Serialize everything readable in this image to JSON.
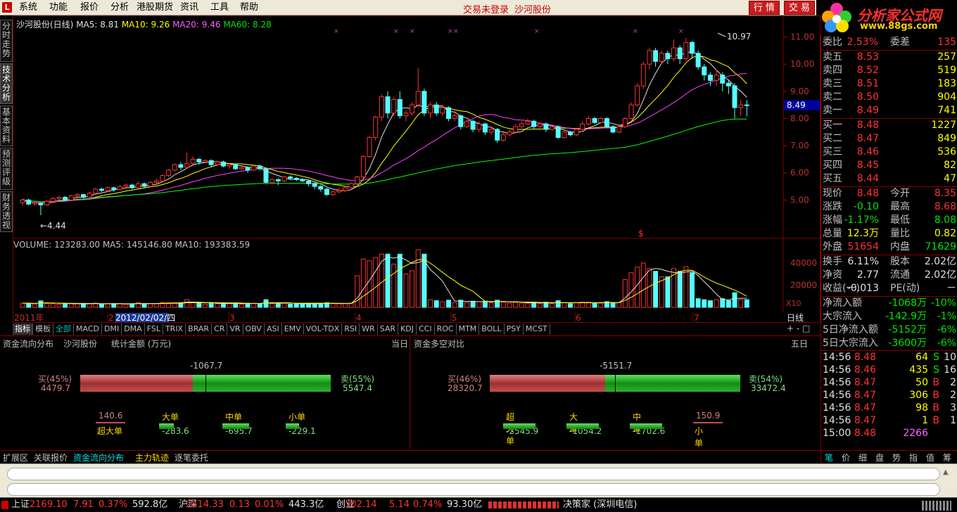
{
  "app": {
    "icon": "L",
    "title": "沙河股份"
  },
  "menu": [
    "系统",
    "功能",
    "报价",
    "分析",
    "港股期货",
    "资讯",
    "工具",
    "帮助"
  ],
  "trade_status": "交易未登录",
  "stock_name_top": "沙河股份",
  "top_buttons": [
    "行 情",
    "交 易"
  ],
  "logo": {
    "text": "分析家公式网",
    "url": "www.88gs.com"
  },
  "side_tabs": [
    "分时走势",
    "技术分析",
    "基本资料",
    "预测评级",
    "财务透视"
  ],
  "chart": {
    "title": "沙河股份(日线)",
    "ma5": "MA5: 8.81",
    "ma10": "MA10: 9.26",
    "ma20": "MA20: 9.46",
    "ma60": "MA60: 8.28",
    "colors": {
      "ma5": "#e0e0e0",
      "ma10": "#ffff00",
      "ma20": "#ff40ff",
      "ma60": "#00ff00",
      "up": "#ff3232",
      "down": "#54ffff"
    },
    "price_axis": [
      "11.00",
      "10.00",
      "9.00",
      "8.00",
      "7.00",
      "6.00",
      "5.00"
    ],
    "current_price_tag": "8.49",
    "high_label": "10.97",
    "low_label": "4.44",
    "volume_info": "VOLUME: 123283.00  MA5: 145146.80  MA10: 193383.59",
    "volume_axis": [
      "40000",
      "20000"
    ],
    "vol_unit": "X10",
    "date_labels": [
      "2011年",
      "2",
      "2012/02/02/四",
      "3",
      "4",
      "5",
      "6",
      "7"
    ],
    "period": "日线",
    "markers": "×"
  },
  "chart_data": {
    "type": "candlestick",
    "ylim": [
      4.0,
      11.3
    ],
    "candles": [
      [
        4.9,
        5.0,
        4.8,
        5.05
      ],
      [
        5.0,
        4.85,
        4.8,
        5.05
      ],
      [
        4.85,
        4.9,
        4.78,
        4.95
      ],
      [
        4.88,
        4.82,
        4.44,
        4.92
      ],
      [
        4.82,
        4.95,
        4.78,
        5.0
      ],
      [
        4.95,
        5.05,
        4.9,
        5.1
      ],
      [
        5.05,
        5.1,
        5.0,
        5.15
      ],
      [
        5.1,
        5.0,
        4.95,
        5.15
      ],
      [
        5.0,
        5.15,
        4.98,
        5.2
      ],
      [
        5.15,
        5.2,
        5.05,
        5.25
      ],
      [
        5.2,
        5.1,
        5.05,
        5.22
      ],
      [
        5.1,
        5.25,
        5.1,
        5.3
      ],
      [
        5.25,
        5.4,
        5.2,
        5.45
      ],
      [
        5.4,
        5.35,
        5.3,
        5.45
      ],
      [
        5.35,
        5.45,
        5.3,
        5.5
      ],
      [
        5.45,
        5.38,
        5.3,
        5.5
      ],
      [
        5.38,
        5.5,
        5.35,
        5.55
      ],
      [
        5.5,
        5.55,
        5.45,
        5.6
      ],
      [
        5.55,
        5.45,
        5.4,
        5.6
      ],
      [
        5.45,
        5.6,
        5.4,
        5.7
      ],
      [
        5.6,
        5.5,
        5.45,
        5.65
      ],
      [
        5.5,
        5.65,
        5.48,
        5.7
      ],
      [
        5.65,
        5.7,
        5.6,
        5.8
      ],
      [
        5.7,
        5.9,
        5.65,
        5.95
      ],
      [
        5.9,
        6.1,
        5.85,
        6.15
      ],
      [
        6.1,
        6.3,
        6.05,
        6.35
      ],
      [
        6.3,
        6.2,
        6.1,
        6.4
      ],
      [
        6.2,
        6.35,
        6.15,
        6.75
      ],
      [
        6.35,
        6.5,
        6.3,
        6.6
      ],
      [
        6.5,
        6.4,
        6.3,
        6.55
      ],
      [
        6.4,
        6.45,
        6.35,
        6.5
      ],
      [
        6.45,
        6.3,
        6.2,
        6.5
      ],
      [
        6.3,
        6.4,
        6.25,
        6.45
      ],
      [
        6.4,
        6.25,
        6.2,
        6.45
      ],
      [
        6.25,
        6.3,
        6.15,
        6.35
      ],
      [
        6.3,
        6.15,
        6.1,
        6.35
      ],
      [
        6.15,
        6.2,
        6.1,
        6.25
      ],
      [
        6.2,
        6.1,
        6.0,
        6.25
      ],
      [
        6.1,
        6.25,
        6.05,
        6.3
      ],
      [
        6.25,
        6.15,
        6.1,
        6.3
      ],
      [
        6.15,
        5.65,
        5.6,
        6.2
      ],
      [
        5.65,
        5.75,
        5.6,
        5.8
      ],
      [
        5.75,
        5.7,
        5.55,
        5.8
      ],
      [
        5.7,
        5.85,
        5.65,
        5.9
      ],
      [
        5.85,
        5.8,
        5.75,
        5.9
      ],
      [
        5.8,
        5.75,
        5.7,
        5.85
      ],
      [
        5.75,
        5.7,
        5.65,
        5.8
      ],
      [
        5.7,
        5.6,
        5.5,
        5.75
      ],
      [
        5.6,
        5.5,
        5.4,
        5.65
      ],
      [
        5.5,
        5.4,
        5.3,
        5.55
      ],
      [
        5.4,
        5.2,
        5.15,
        5.45
      ],
      [
        5.2,
        5.3,
        5.15,
        5.35
      ],
      [
        5.3,
        5.35,
        5.25,
        5.45
      ],
      [
        5.35,
        5.45,
        5.3,
        5.5
      ],
      [
        5.45,
        5.6,
        5.4,
        5.65
      ],
      [
        5.6,
        5.85,
        5.55,
        5.9
      ],
      [
        5.85,
        6.6,
        5.8,
        6.65
      ],
      [
        6.6,
        7.3,
        6.55,
        7.35
      ],
      [
        7.3,
        8.05,
        7.2,
        8.1
      ],
      [
        8.05,
        8.8,
        7.9,
        8.9
      ],
      [
        8.8,
        8.2,
        8.0,
        9.0
      ],
      [
        8.2,
        8.7,
        8.1,
        8.8
      ],
      [
        8.7,
        8.1,
        8.0,
        9.0
      ],
      [
        8.1,
        8.2,
        7.9,
        8.3
      ],
      [
        8.2,
        8.5,
        8.1,
        8.6
      ],
      [
        8.5,
        9.0,
        8.4,
        9.85
      ],
      [
        9.0,
        8.2,
        8.1,
        9.1
      ],
      [
        8.2,
        8.5,
        8.0,
        8.6
      ],
      [
        8.5,
        8.2,
        8.1,
        8.6
      ],
      [
        8.2,
        8.4,
        8.1,
        8.5
      ],
      [
        8.4,
        8.0,
        7.9,
        8.45
      ],
      [
        8.0,
        8.1,
        7.9,
        8.2
      ],
      [
        8.1,
        7.7,
        7.6,
        8.15
      ],
      [
        7.7,
        7.9,
        7.65,
        7.95
      ],
      [
        7.9,
        7.6,
        7.5,
        7.95
      ],
      [
        7.6,
        7.8,
        7.5,
        7.9
      ],
      [
        7.8,
        7.5,
        7.4,
        7.85
      ],
      [
        7.5,
        7.6,
        7.4,
        7.7
      ],
      [
        7.6,
        7.2,
        7.1,
        7.65
      ],
      [
        7.2,
        7.4,
        7.15,
        7.5
      ],
      [
        7.4,
        7.5,
        7.35,
        7.6
      ],
      [
        7.5,
        7.7,
        7.45,
        7.8
      ],
      [
        7.7,
        7.8,
        7.65,
        7.9
      ],
      [
        7.8,
        7.9,
        7.75,
        8.0
      ],
      [
        7.9,
        7.7,
        7.6,
        7.95
      ],
      [
        7.7,
        7.8,
        7.65,
        7.85
      ],
      [
        7.8,
        7.6,
        7.5,
        7.85
      ],
      [
        7.6,
        7.7,
        7.55,
        7.75
      ],
      [
        7.7,
        7.3,
        7.25,
        7.75
      ],
      [
        7.3,
        7.5,
        7.25,
        7.55
      ],
      [
        7.5,
        7.4,
        7.35,
        7.55
      ],
      [
        7.4,
        7.6,
        7.35,
        7.65
      ],
      [
        7.6,
        7.8,
        7.55,
        7.9
      ],
      [
        7.8,
        8.0,
        7.75,
        8.1
      ],
      [
        8.0,
        7.85,
        7.8,
        8.05
      ],
      [
        7.85,
        8.0,
        7.8,
        8.05
      ],
      [
        8.0,
        7.7,
        7.65,
        8.05
      ],
      [
        7.7,
        7.5,
        7.45,
        7.75
      ],
      [
        7.5,
        7.7,
        7.45,
        7.75
      ],
      [
        7.7,
        8.0,
        7.65,
        8.05
      ],
      [
        8.0,
        8.5,
        7.95,
        8.6
      ],
      [
        8.5,
        9.2,
        8.45,
        9.3
      ],
      [
        9.2,
        10.0,
        9.1,
        10.1
      ],
      [
        10.0,
        10.5,
        9.8,
        10.6
      ],
      [
        10.5,
        10.1,
        9.9,
        10.6
      ],
      [
        10.1,
        10.4,
        10.0,
        10.5
      ],
      [
        10.4,
        10.2,
        10.0,
        10.5
      ],
      [
        10.2,
        10.6,
        10.1,
        10.9
      ],
      [
        10.6,
        10.2,
        10.0,
        10.7
      ],
      [
        10.2,
        10.8,
        10.1,
        10.97
      ],
      [
        10.8,
        10.4,
        10.2,
        10.85
      ],
      [
        10.4,
        9.9,
        9.8,
        10.5
      ],
      [
        9.9,
        9.6,
        9.4,
        10.0
      ],
      [
        9.6,
        9.4,
        9.2,
        9.7
      ],
      [
        9.4,
        9.6,
        9.2,
        9.8
      ],
      [
        9.6,
        9.3,
        9.0,
        9.7
      ],
      [
        9.3,
        9.2,
        8.9,
        9.4
      ],
      [
        9.2,
        8.4,
        8.0,
        9.3
      ],
      [
        8.4,
        8.5,
        8.1,
        8.7
      ],
      [
        8.5,
        8.49,
        8.08,
        8.68
      ]
    ],
    "ma_series": [
      {
        "name": "MA5"
      },
      {
        "name": "MA10"
      },
      {
        "name": "MA20"
      },
      {
        "name": "MA60"
      }
    ]
  },
  "indicator_tabs": [
    "指标",
    "模板",
    "全部",
    "MACD",
    "DMI",
    "DMA",
    "FSL",
    "TRIX",
    "BRAR",
    "CR",
    "VR",
    "OBV",
    "ASI",
    "EMV",
    "VOL-TDX",
    "RSI",
    "WR",
    "SAR",
    "KDJ",
    "CCI",
    "ROC",
    "MTM",
    "BOLL",
    "PSY",
    "MCST"
  ],
  "fund_left": {
    "title": "资金流向分布",
    "stock": "沙河股份",
    "unit": "统计金额 (万元)",
    "range": "当日",
    "net": "-1067.7",
    "buy_pct": "买(45%)",
    "buy_amt": "4479.7",
    "sell_pct": "卖(55%)",
    "sell_amt": "5547.4",
    "buy_ratio": 0.45,
    "cats": [
      {
        "name": "超大单",
        "val": "140.6"
      },
      {
        "name": "大单",
        "val": "-283.6"
      },
      {
        "name": "中单",
        "val": "-695.7"
      },
      {
        "name": "小单",
        "val": "-229.1"
      }
    ]
  },
  "fund_right": {
    "title": "资金多空对比",
    "range": "五日",
    "net": "-5151.7",
    "buy_pct": "买(46%)",
    "buy_amt": "28320.7",
    "sell_pct": "卖(54%)",
    "sell_amt": "33472.4",
    "buy_ratio": 0.46,
    "cats": [
      {
        "name": "超大单",
        "val": "-2545.9"
      },
      {
        "name": "大单",
        "val": "-1054.2"
      },
      {
        "name": "中单",
        "val": "-1702.6"
      },
      {
        "name": "小单",
        "val": "150.9"
      }
    ]
  },
  "bottom_tabs": [
    "扩展区",
    "关联报价",
    "资金流向分布",
    "主力轨迹",
    "逐笔委托"
  ],
  "quote": {
    "ratio": {
      "lbl": "委比",
      "val": "2.53%",
      "lbl2": "委差",
      "val2": "135"
    },
    "asks": [
      {
        "lbl": "卖五",
        "p": "8.53",
        "v": "257"
      },
      {
        "lbl": "卖四",
        "p": "8.52",
        "v": "519"
      },
      {
        "lbl": "卖三",
        "p": "8.51",
        "v": "183"
      },
      {
        "lbl": "卖二",
        "p": "8.50",
        "v": "904"
      },
      {
        "lbl": "卖一",
        "p": "8.49",
        "v": "741"
      }
    ],
    "bids": [
      {
        "lbl": "买一",
        "p": "8.48",
        "v": "1227"
      },
      {
        "lbl": "买二",
        "p": "8.47",
        "v": "849"
      },
      {
        "lbl": "买三",
        "p": "8.46",
        "v": "536"
      },
      {
        "lbl": "买四",
        "p": "8.45",
        "v": "82"
      },
      {
        "lbl": "买五",
        "p": "8.44",
        "v": "47"
      }
    ],
    "stats": [
      [
        "现价",
        "8.48",
        "今开",
        "8.35"
      ],
      [
        "涨跌",
        "-0.10",
        "最高",
        "8.68"
      ],
      [
        "涨幅",
        "-1.17%",
        "最低",
        "8.08"
      ],
      [
        "总量",
        "12.3万",
        "量比",
        "0.82"
      ],
      [
        "外盘",
        "51654",
        "内盘",
        "71629"
      ]
    ],
    "info": [
      [
        "换手",
        "6.11%",
        "股本",
        "2.02亿"
      ],
      [
        "净资",
        "2.77",
        "流通",
        "2.02亿"
      ],
      [
        "收益(一)",
        "-0.013",
        "PE(动)",
        "－"
      ]
    ],
    "flow": [
      [
        "净流入额",
        "-1068万",
        "-10%"
      ],
      [
        "大宗流入",
        "-142.9万",
        "-1%"
      ],
      [
        "5日净流入额",
        "-5152万",
        "-6%"
      ],
      [
        "5日大宗流入",
        "-3600万",
        "-6%"
      ]
    ],
    "ticks": [
      [
        "14:56",
        "8.48",
        "64",
        "S",
        "10"
      ],
      [
        "14:56",
        "8.46",
        "435",
        "S",
        "16"
      ],
      [
        "14:56",
        "8.47",
        "50",
        "B",
        "2"
      ],
      [
        "14:56",
        "8.47",
        "306",
        "B",
        "2"
      ],
      [
        "14:56",
        "8.47",
        "98",
        "B",
        "3"
      ],
      [
        "14:56",
        "8.47",
        "1",
        "B",
        "1"
      ],
      [
        "15:00",
        "8.48",
        "2266",
        "",
        ""
      ]
    ]
  },
  "right_tabs": [
    "笔",
    "价",
    "细",
    "盘",
    "势",
    "指",
    "值",
    "筹"
  ],
  "statusbar": [
    {
      "name": "上证",
      "price": "2169.10",
      "chg": "7.91",
      "pct": "0.37%",
      "amt": "592.8亿"
    },
    {
      "name": "沪深",
      "price": "2414.33",
      "chg": "0.13",
      "pct": "0.01%",
      "amt": "443.3亿"
    },
    {
      "name": "创业",
      "price": "702.14",
      "chg": "5.14",
      "pct": "0.74%",
      "amt": "93.30亿"
    }
  ],
  "status_right": "决策家 (深圳电信)"
}
